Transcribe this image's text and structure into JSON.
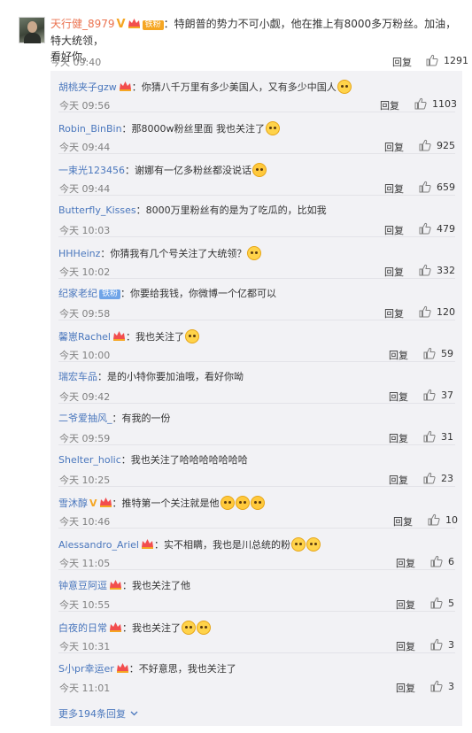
{
  "main_comment": {
    "username": "天行健_8979",
    "badge": "铁粉",
    "text_line1": "：特朗普的势力不可小觑，他在推上有8000多万粉丝。加油，特大统领，",
    "text_line2": "看好你。",
    "time": "今天 09:40",
    "reply_label": "回复",
    "likes": "1291"
  },
  "replies": [
    {
      "username": "胡桃夹子gzw",
      "text": "：你猜八千万里有多少美国人，又有多少中国人",
      "time": "今天 09:56",
      "reply_label": "回复",
      "likes": "1103"
    },
    {
      "username": "Robin_BinBin",
      "text": "：那8000w粉丝里面 我也关注了",
      "time": "今天 09:44",
      "reply_label": "回复",
      "likes": "925"
    },
    {
      "username": "一束光123456",
      "text": "：谢娜有一亿多粉丝都没说话",
      "time": "今天 09:44",
      "reply_label": "回复",
      "likes": "659"
    },
    {
      "username": "Butterfly_Kisses",
      "text": "：8000万里粉丝有的是为了吃瓜的，比如我",
      "time": "今天 10:03",
      "reply_label": "回复",
      "likes": "479"
    },
    {
      "username": "HHHeinz",
      "text": "：你猜我有几个号关注了大统领？",
      "time": "今天 10:02",
      "reply_label": "回复",
      "likes": "332"
    },
    {
      "username": "纪家老纪",
      "badge": "铁粉",
      "text": "：你要给我钱，你微博一个亿都可以",
      "time": "今天 09:58",
      "reply_label": "回复",
      "likes": "120"
    },
    {
      "username": "馨崽Rachel",
      "text": "：我也关注了",
      "time": "今天 10:00",
      "reply_label": "回复",
      "likes": "59"
    },
    {
      "username": "瑞宏车品",
      "text": "：是的小特你要加油哦，看好你呦",
      "time": "今天 09:42",
      "reply_label": "回复",
      "likes": "37"
    },
    {
      "username": "二爷爱抽风_",
      "text": "：有我的一份",
      "time": "今天 09:59",
      "reply_label": "回复",
      "likes": "31"
    },
    {
      "username": "Shelter_holic",
      "text": "：我也关注了哈哈哈哈哈哈哈",
      "time": "今天 10:25",
      "reply_label": "回复",
      "likes": "23"
    },
    {
      "username": "雪沐醇",
      "text": "：推特第一个关注就是他",
      "time": "今天 10:46",
      "reply_label": "回复",
      "likes": "10"
    },
    {
      "username": "Alessandro_Ariel",
      "text": "：实不相瞒，我也是川总统的粉",
      "time": "今天 11:05",
      "reply_label": "回复",
      "likes": "6"
    },
    {
      "username": "钟意豆阿逗",
      "text": "：我也关注了他",
      "time": "今天 10:55",
      "reply_label": "回复",
      "likes": "5"
    },
    {
      "username": "白夜的日常",
      "text": "：我也关注了",
      "time": "今天 10:31",
      "reply_label": "回复",
      "likes": "3"
    },
    {
      "username": "S小pr幸运er",
      "text": "：不好意思，我也关注了",
      "time": "今天 11:01",
      "reply_label": "回复",
      "likes": "3"
    }
  ],
  "more_label": "更多194条回复",
  "icons": {
    "like": "thumbs-up-icon",
    "verified": "verified-v-icon",
    "vip": "vip-crown-icon",
    "more": "chevron-down-icon"
  },
  "colors": {
    "username": "#4a77bd",
    "main_username": "#eb7350",
    "panel_bg": "#f2f2f5",
    "badge": "#f5a623"
  }
}
